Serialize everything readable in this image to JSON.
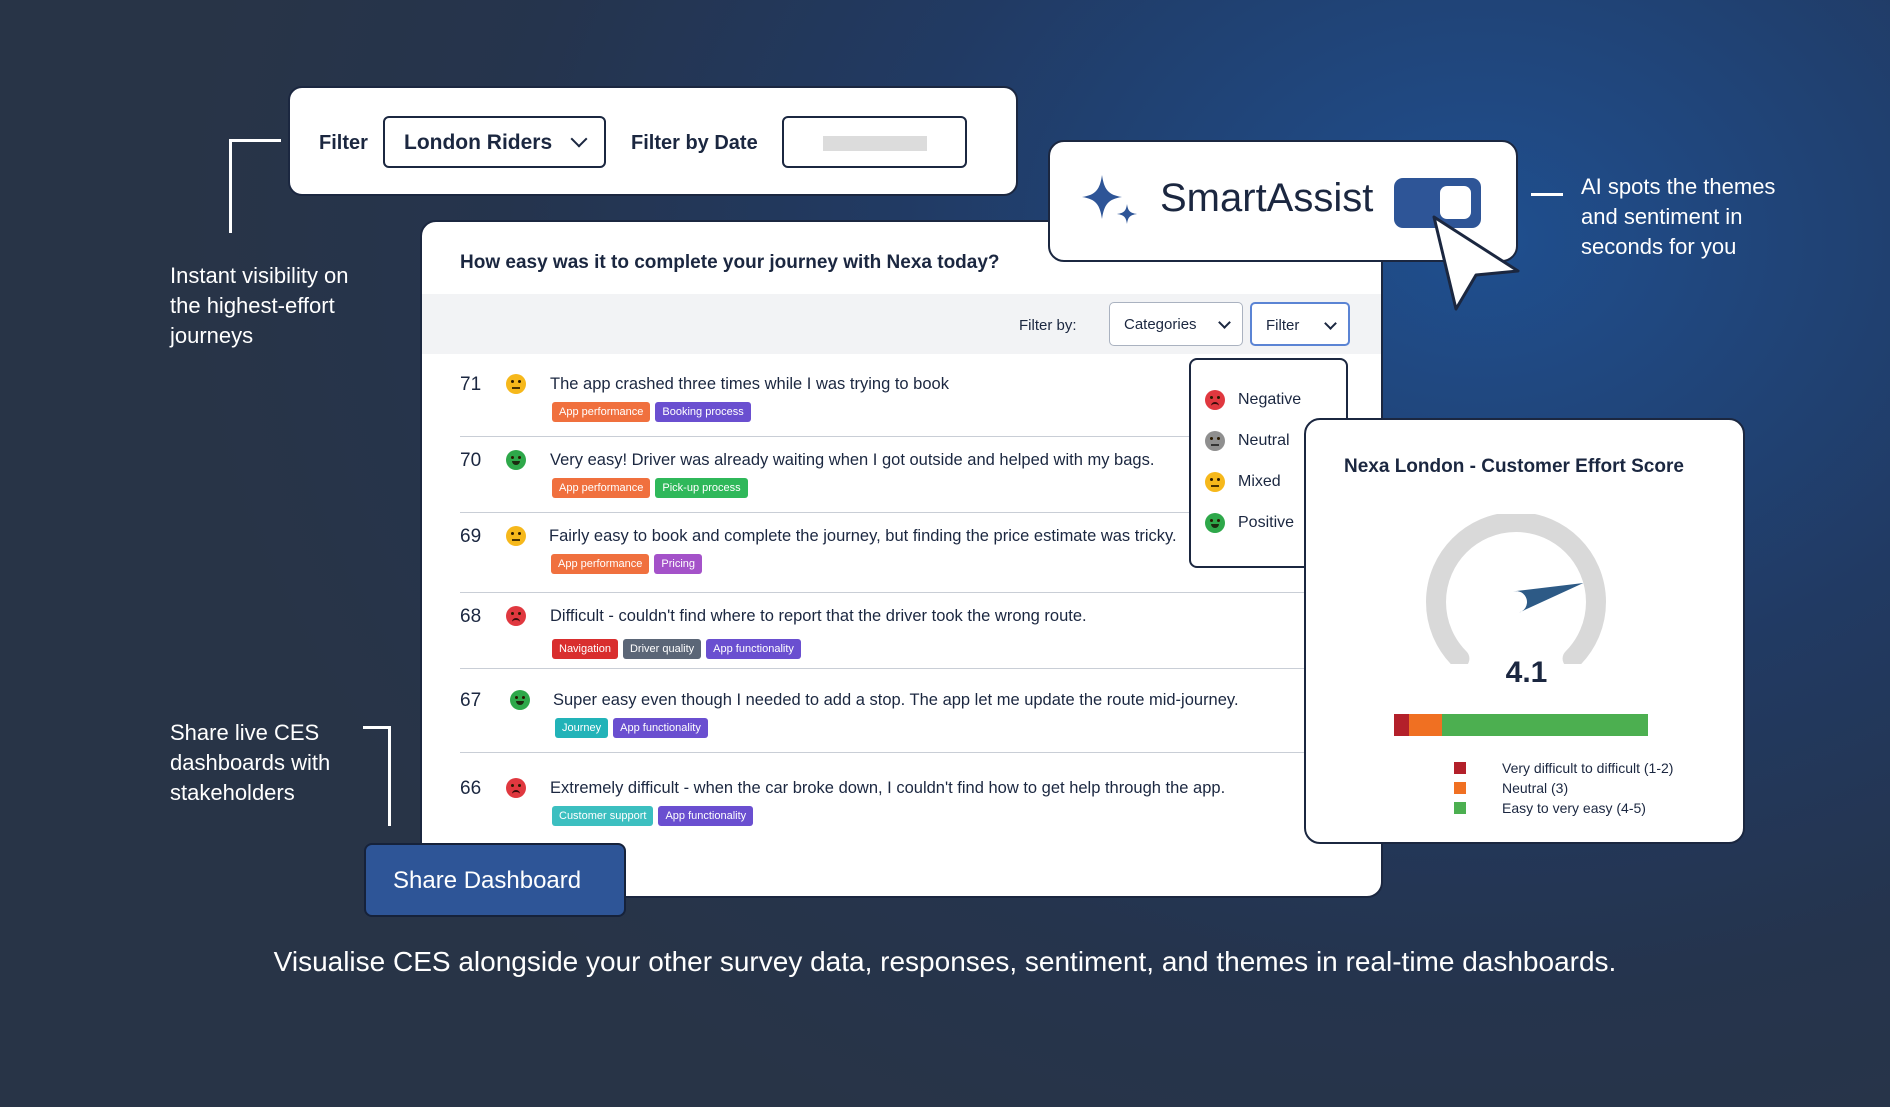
{
  "filter_bar": {
    "filter_label": "Filter",
    "filter_value": "London Riders",
    "date_label": "Filter by Date"
  },
  "survey": {
    "question": "How easy was it to complete your journey with Nexa today?",
    "filter_by_label": "Filter by:",
    "categories_select": "Categories",
    "filter_select": "Filter",
    "responses": [
      {
        "num": "71",
        "sentiment": "mixed",
        "text": "The app crashed three times while I was trying to book",
        "tags": [
          {
            "label": "App performance",
            "color": "#f0703e"
          },
          {
            "label": "Booking process",
            "color": "#6a4fd0"
          }
        ]
      },
      {
        "num": "70",
        "sentiment": "positive",
        "text": "Very easy! Driver was already waiting when I got outside and helped with my bags.",
        "tags": [
          {
            "label": "App performance",
            "color": "#f0703e"
          },
          {
            "label": "Pick-up process",
            "color": "#2fb85a"
          }
        ]
      },
      {
        "num": "69",
        "sentiment": "mixed",
        "text": "Fairly easy to book and complete the journey, but finding the price estimate was tricky.",
        "tags": [
          {
            "label": "App performance",
            "color": "#f0703e"
          },
          {
            "label": "Pricing",
            "color": "#a452c9"
          }
        ]
      },
      {
        "num": "68",
        "sentiment": "negative",
        "text": "Difficult - couldn't find where to report that the driver took the wrong route.",
        "tags": [
          {
            "label": "Navigation",
            "color": "#d92e2e"
          },
          {
            "label": "Driver quality",
            "color": "#5b6677"
          },
          {
            "label": "App functionality",
            "color": "#6a4fd0"
          }
        ]
      },
      {
        "num": "67",
        "sentiment": "positive",
        "text": "Super easy even though I needed to add a stop. The app let me update the route mid-journey.",
        "tags": [
          {
            "label": "Journey",
            "color": "#22b3b8"
          },
          {
            "label": "App functionality",
            "color": "#6a4fd0"
          }
        ]
      },
      {
        "num": "66",
        "sentiment": "negative",
        "text": "Extremely difficult - when the car broke down, I couldn't find how to get help through the app.",
        "tags": [
          {
            "label": "Customer support",
            "color": "#3cbfc0"
          },
          {
            "label": "App functionality",
            "color": "#6a4fd0"
          }
        ]
      }
    ]
  },
  "sentiment_menu": {
    "items": [
      {
        "label": "Negative",
        "sentiment": "negative"
      },
      {
        "label": "Neutral",
        "sentiment": "neutral"
      },
      {
        "label": "Mixed",
        "sentiment": "mixed"
      },
      {
        "label": "Positive",
        "sentiment": "positive"
      }
    ]
  },
  "smartassist": {
    "label": "SmartAssist",
    "toggle_on": true,
    "accent": "#2e5597"
  },
  "ces_card": {
    "title": "Nexa London - Customer Effort Score",
    "score": "4.1",
    "score_value": 4.1,
    "scale": [
      1,
      5
    ],
    "distribution": [
      {
        "label": "Very difficult to difficult (1-2)",
        "share": 0.06,
        "color": "#b3202a"
      },
      {
        "label": "Neutral (3)",
        "share": 0.13,
        "color": "#f07022"
      },
      {
        "label": "Easy to very easy (4-5)",
        "share": 0.81,
        "color": "#4caf50"
      }
    ]
  },
  "share_button": {
    "label": "Share Dashboard"
  },
  "annotations": {
    "left_top": "Instant visibility on the highest-effort journeys",
    "left_bottom": "Share live CES dashboards with stakeholders",
    "right_top": "AI spots the themes and sentiment in seconds for you"
  },
  "caption": "Visualise CES alongside your other survey data, responses, sentiment, and themes in real-time dashboards.",
  "colors": {
    "positive": "#2ea84a",
    "negative": "#e0383f",
    "mixed": "#f6b81b",
    "neutral": "#8f8f8f"
  }
}
